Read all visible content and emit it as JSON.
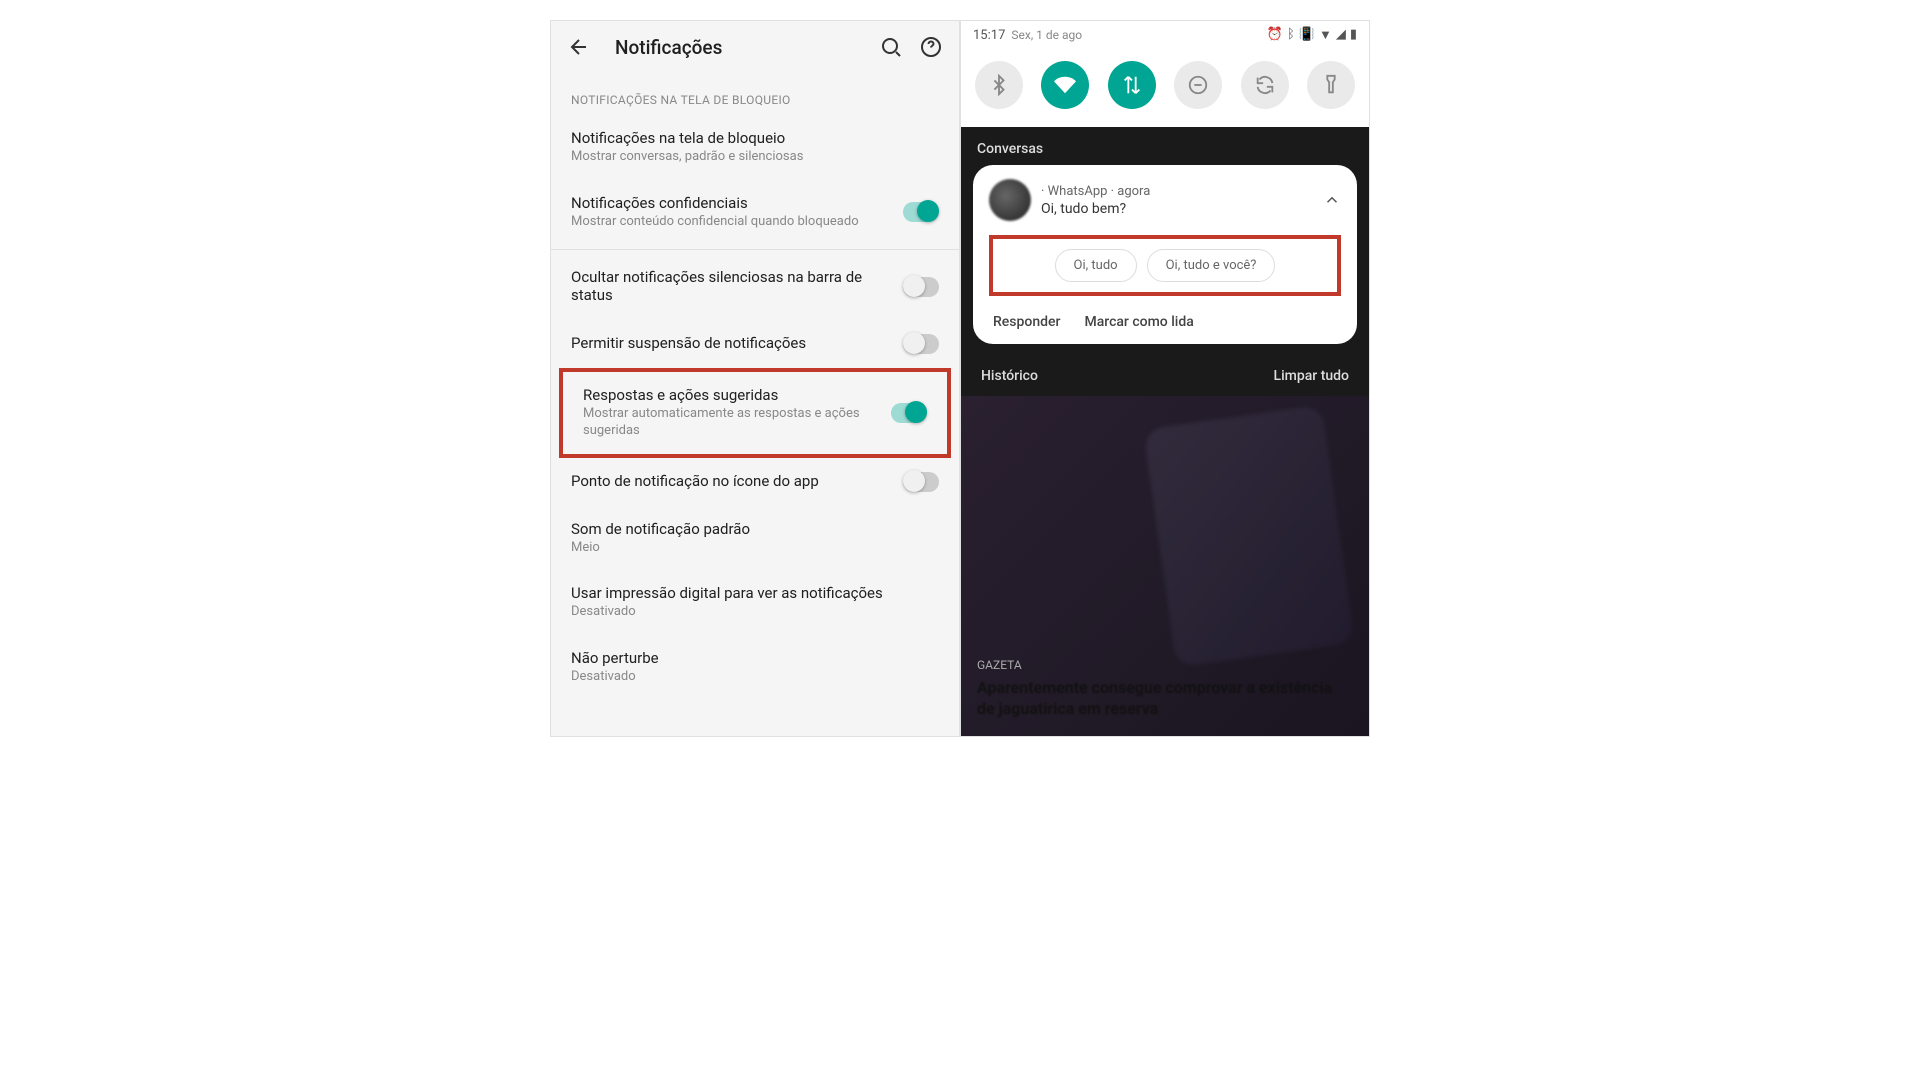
{
  "left": {
    "header_title": "Notificações",
    "section1_header": "NOTIFICAÇÕES NA TELA DE BLOQUEIO",
    "items": [
      {
        "title": "Notificações na tela de bloqueio",
        "subtitle": "Mostrar conversas, padrão e silenciosas"
      },
      {
        "title": "Notificações confidenciais",
        "subtitle": "Mostrar conteúdo confidencial quando bloqueado"
      },
      {
        "title": "Ocultar notificações silenciosas na barra de status",
        "subtitle": ""
      },
      {
        "title": "Permitir suspensão de notificações",
        "subtitle": ""
      },
      {
        "title": "Respostas e ações sugeridas",
        "subtitle": "Mostrar automaticamente as respostas e ações sugeridas"
      },
      {
        "title": "Ponto de notificação no ícone do app",
        "subtitle": ""
      },
      {
        "title": "Som de notificação padrão",
        "subtitle": "Meio"
      },
      {
        "title": "Usar impressão digital para ver as notificações",
        "subtitle": "Desativado"
      },
      {
        "title": "Não perturbe",
        "subtitle": "Desativado"
      }
    ]
  },
  "right": {
    "status_time": "15:17",
    "status_date": "Sex, 1 de ago",
    "qs_tiles": [
      {
        "name": "bluetooth-icon",
        "state": "off"
      },
      {
        "name": "wifi-icon",
        "state": "on"
      },
      {
        "name": "data-icon",
        "state": "on"
      },
      {
        "name": "dnd-icon",
        "state": "off"
      },
      {
        "name": "autorotate-icon",
        "state": "off"
      },
      {
        "name": "flashlight-icon",
        "state": "off"
      }
    ],
    "section_conversas": "Conversas",
    "notif": {
      "app_line": "· WhatsApp · agora",
      "contact": "",
      "message": "Oi, tudo bem?",
      "suggestions": [
        "Oi, tudo",
        "Oi, tudo e você?"
      ],
      "action_reply": "Responder",
      "action_read": "Marcar como lida"
    },
    "history_label": "Histórico",
    "clear_label": "Limpar tudo",
    "article": {
      "tag": "GAZETA",
      "title": "Aparentemente consegue comprovar a existência de jaguatirica em reserva"
    }
  }
}
